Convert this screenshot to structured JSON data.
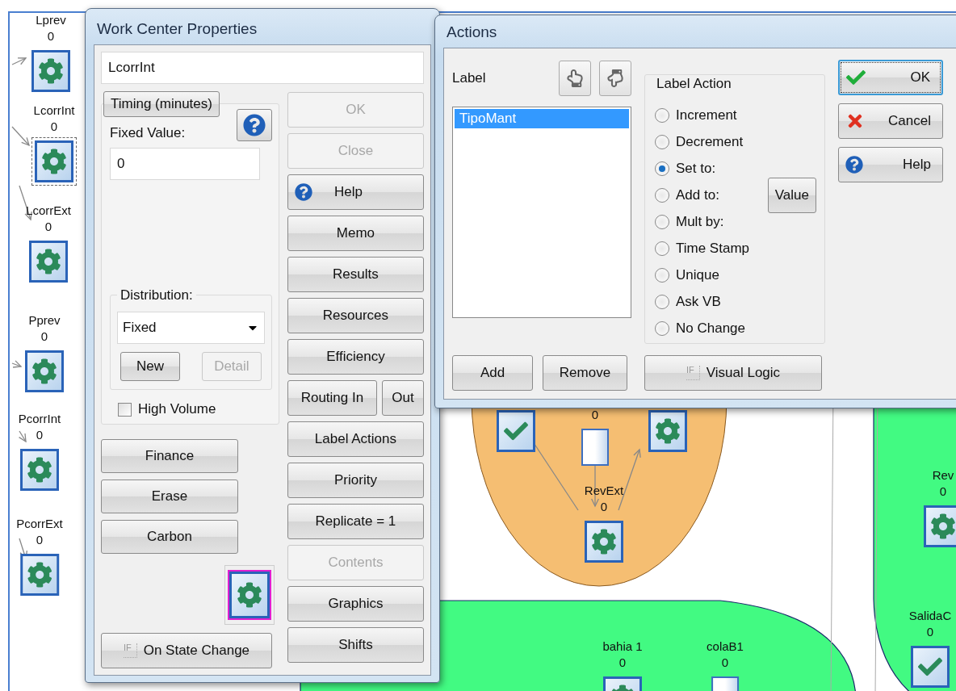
{
  "canvas": {
    "regions": [
      {
        "kind": "ellipse",
        "color": "#f5be72"
      },
      {
        "kind": "bottom",
        "color": "#42fa82"
      },
      {
        "kind": "right",
        "color": "#42fa82"
      }
    ],
    "nodes": [
      {
        "label": "Lprev",
        "count": "0",
        "kind": "gear",
        "selected": false
      },
      {
        "label": "LcorrInt",
        "count": "0",
        "kind": "gear",
        "selected": true
      },
      {
        "label": "LcorrExt",
        "count": "0",
        "kind": "gear",
        "selected": false
      },
      {
        "label": "Pprev",
        "count": "0",
        "kind": "gear",
        "selected": false
      },
      {
        "label": "PcorrInt",
        "count": "0",
        "kind": "gear",
        "selected": false
      },
      {
        "label": "PcorrExt",
        "count": "0",
        "kind": "gear",
        "selected": false
      },
      {
        "kind": "check",
        "selected": false
      },
      {
        "count": "0",
        "kind": "queue",
        "selected": false
      },
      {
        "kind": "gear",
        "selected": false
      },
      {
        "label": "RevExt",
        "count": "0",
        "kind": "gear",
        "selected": false
      },
      {
        "label": "bahia 1",
        "count": "0",
        "kind": "gear",
        "selected": false
      },
      {
        "label": "colaB1",
        "count": "0",
        "kind": "queue",
        "selected": false
      },
      {
        "label": "Rev",
        "count": "0",
        "kind": "gear",
        "selected": false
      },
      {
        "label": "SalidaC",
        "count": "0",
        "kind": "check",
        "selected": false
      }
    ]
  },
  "work_center": {
    "title": "Work Center Properties",
    "name_value": "LcorrInt",
    "timing": {
      "button": "Timing (minutes)",
      "fixed_label": "Fixed Value:",
      "fixed_value": "0"
    },
    "distribution": {
      "label": "Distribution:",
      "value": "Fixed",
      "buttons": [
        {
          "label": "New",
          "disabled": false
        },
        {
          "label": "Detail",
          "disabled": true
        }
      ]
    },
    "high_volume": {
      "label": "High Volume",
      "checked": false
    },
    "left_buttons": [
      "Finance",
      "Erase",
      "Carbon"
    ],
    "on_state_change": {
      "badge": "IF",
      "label": "On State Change"
    },
    "side_buttons": [
      [
        {
          "label": "OK",
          "disabled": true,
          "kind": "plain"
        }
      ],
      [
        {
          "label": "Close",
          "disabled": true,
          "kind": "plain"
        }
      ],
      [
        {
          "label": "Help",
          "disabled": false,
          "kind": "help"
        }
      ],
      [
        {
          "label": "Memo",
          "disabled": false,
          "kind": "plain"
        }
      ],
      [
        {
          "label": "Results",
          "disabled": false,
          "kind": "plain"
        }
      ],
      [
        {
          "label": "Resources",
          "disabled": false,
          "kind": "plain"
        }
      ],
      [
        {
          "label": "Efficiency",
          "disabled": false,
          "kind": "plain"
        }
      ],
      [
        {
          "label": "Routing In",
          "disabled": false,
          "kind": "plain"
        },
        {
          "label": "Out",
          "disabled": false,
          "kind": "plain"
        }
      ],
      [
        {
          "label": "Label Actions",
          "disabled": false,
          "kind": "plain"
        }
      ],
      [
        {
          "label": "Priority",
          "disabled": false,
          "kind": "plain"
        }
      ],
      [
        {
          "label": "Replicate = 1",
          "disabled": false,
          "kind": "plain"
        }
      ],
      [
        {
          "label": "Contents",
          "disabled": true,
          "kind": "plain"
        }
      ],
      [
        {
          "label": "Graphics",
          "disabled": false,
          "kind": "plain"
        }
      ],
      [
        {
          "label": "Shifts",
          "disabled": false,
          "kind": "plain"
        }
      ]
    ]
  },
  "actions": {
    "title": "Actions",
    "label_heading": "Label",
    "labels": [
      {
        "text": "TipoMant",
        "selected": true
      }
    ],
    "action_heading": "Label Action",
    "options": [
      {
        "label": "Increment",
        "selected": false
      },
      {
        "label": "Decrement",
        "selected": false
      },
      {
        "label": "Set to:",
        "selected": true
      },
      {
        "label": "Add to:",
        "selected": false
      },
      {
        "label": "Mult by:",
        "selected": false
      },
      {
        "label": "Time Stamp",
        "selected": false
      },
      {
        "label": "Unique",
        "selected": false
      },
      {
        "label": "Ask VB",
        "selected": false
      },
      {
        "label": "No Change",
        "selected": false
      }
    ],
    "value_button": "Value",
    "list_buttons": [
      "Add",
      "Remove"
    ],
    "logic_button": {
      "badge": "IF",
      "label": "Visual Logic"
    },
    "dialog_buttons": [
      {
        "label": "OK",
        "kind": "ok",
        "focused": true
      },
      {
        "label": "Cancel",
        "kind": "cancel",
        "focused": false
      },
      {
        "label": "Help",
        "kind": "help",
        "focused": false
      }
    ]
  }
}
